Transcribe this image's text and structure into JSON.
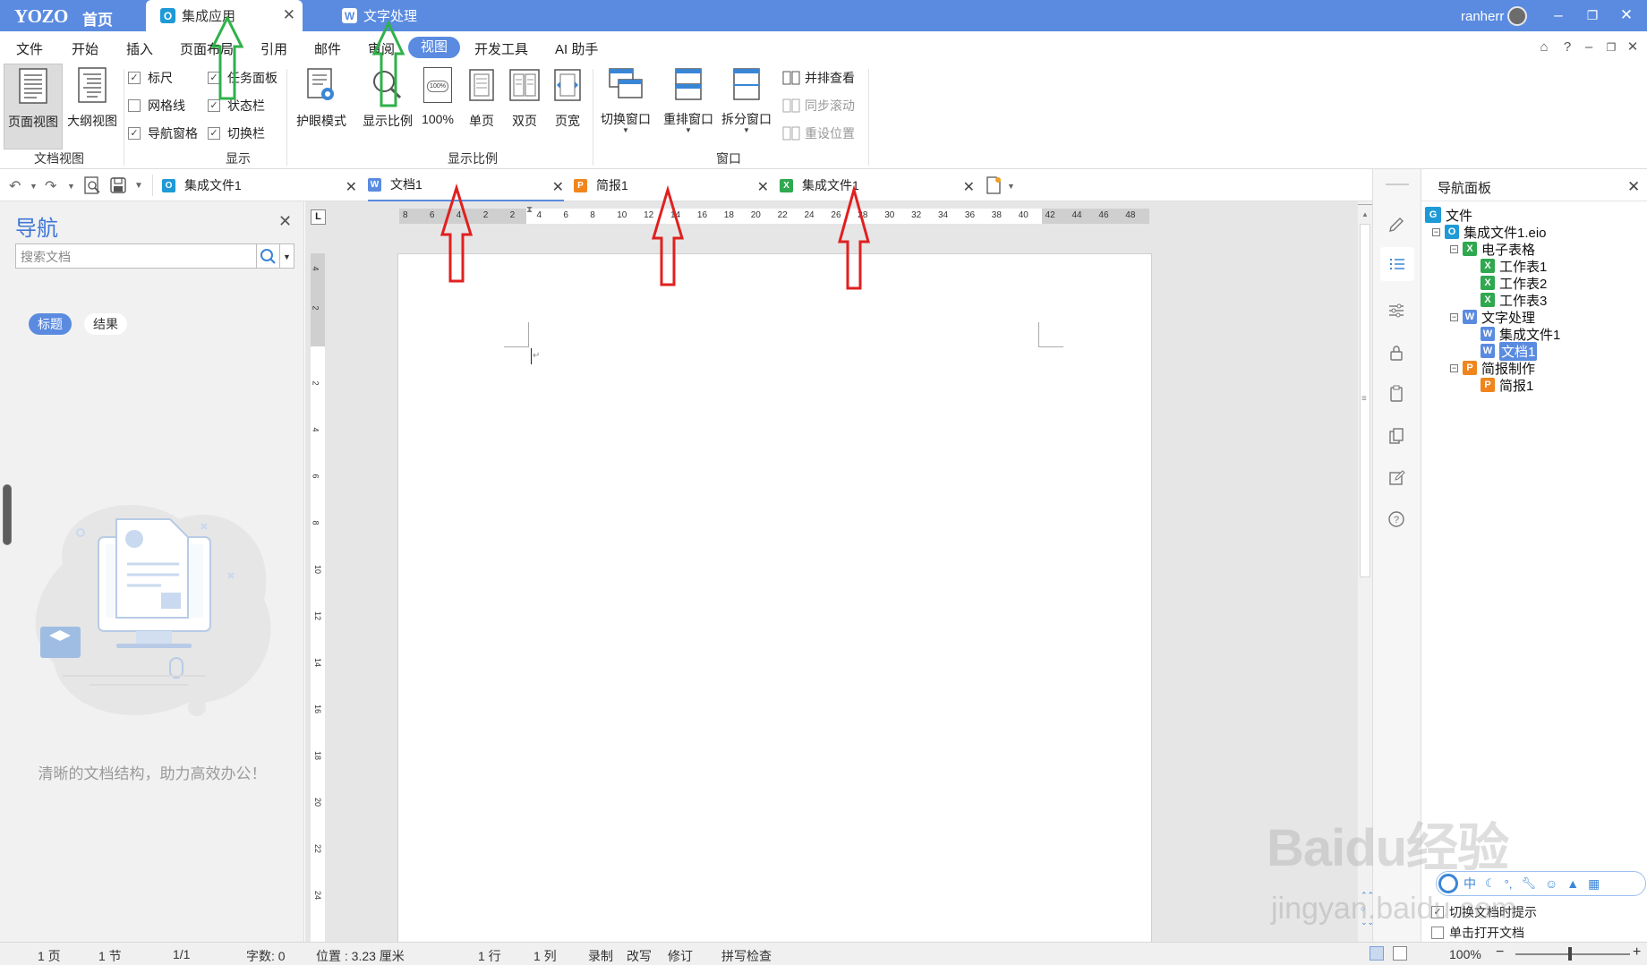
{
  "app": {
    "logo": "YOZO",
    "home_label": "首页",
    "title_tabs": [
      {
        "label": "集成应用",
        "icon": "O",
        "icon_color": "#1e9ad6"
      },
      {
        "label": "文字处理",
        "icon": "W",
        "icon_color": "#5a8be0"
      }
    ],
    "username": "ranherr",
    "accent_color": "#5a8be0"
  },
  "menu": {
    "items": [
      "文件",
      "开始",
      "插入",
      "页面布局",
      "引用",
      "邮件",
      "审阅",
      "视图",
      "开发工具",
      "AI 助手"
    ],
    "active": "视图"
  },
  "ribbon": {
    "doc_view": {
      "page_view": "页面视图",
      "outline_view": "大纲视图",
      "group": "文档视图"
    },
    "show": {
      "ruler": {
        "label": "标尺",
        "checked": true
      },
      "gridlines": {
        "label": "网格线",
        "checked": false
      },
      "nav_pane": {
        "label": "导航窗格",
        "checked": true
      },
      "task_pane": {
        "label": "任务面板",
        "checked": true
      },
      "status_bar": {
        "label": "状态栏",
        "checked": true
      },
      "switch_bar": {
        "label": "切换栏",
        "checked": true
      },
      "group": "显示"
    },
    "zoom": {
      "eye_mode": "护眼模式",
      "zoom_ratio": "显示比例",
      "hundred": "100%",
      "hundred_icon_text": "100%",
      "single": "单页",
      "double": "双页",
      "width": "页宽",
      "group": "显示比例"
    },
    "window": {
      "switch": "切换窗口",
      "rearrange": "重排窗口",
      "split": "拆分窗口",
      "side_by_side": "并排查看",
      "sync_scroll": "同步滚动",
      "reset_pos": "重设位置",
      "group": "窗口"
    }
  },
  "doc_tabs": [
    {
      "label": "集成文件1",
      "icon": "O",
      "color": "#1e9ad6"
    },
    {
      "label": "文档1",
      "icon": "W",
      "color": "#5a8be0"
    },
    {
      "label": "简报1",
      "icon": "P",
      "color": "#f0851d"
    },
    {
      "label": "集成文件1",
      "icon": "X",
      "color": "#2fa84f"
    }
  ],
  "nav": {
    "title": "导航",
    "search_placeholder": "搜索文档",
    "tab_headings": "标题",
    "tab_results": "结果",
    "slogan": "清晰的文档结构，助力高效办公！"
  },
  "ruler": {
    "corner": "L",
    "h_ticks": [
      "8",
      "6",
      "4",
      "2",
      "2",
      "4",
      "6",
      "8",
      "10",
      "12",
      "14",
      "16",
      "18",
      "20",
      "22",
      "24",
      "26",
      "28",
      "30",
      "32",
      "34",
      "36",
      "38",
      "40",
      "42",
      "44",
      "46",
      "48"
    ],
    "v_ticks": [
      "4",
      "2",
      "2",
      "4",
      "6",
      "8",
      "10",
      "12",
      "14",
      "16",
      "18",
      "20",
      "22",
      "24"
    ]
  },
  "nav_panel": {
    "title": "导航面板",
    "tree": {
      "root": "文件",
      "file": "集成文件1.eio",
      "spreadsheet": "电子表格",
      "sheets": [
        "工作表1",
        "工作表2",
        "工作表3"
      ],
      "word": "文字处理",
      "word_items": [
        "集成文件1",
        "文档1"
      ],
      "ppt": "简报制作",
      "ppt_items": [
        "简报1"
      ]
    },
    "switch_label": "切换文档时提示",
    "single_click_label": "单击打开文档",
    "switch_checked": true,
    "single_click_checked": false
  },
  "ime_bar": {
    "mode": "中"
  },
  "status": {
    "page": "1 页",
    "section": "1 节",
    "pages": "1/1",
    "words": "字数: 0",
    "position": "位置 : 3.23 厘米",
    "line": "1 行",
    "col": "1 列",
    "record": "录制",
    "overwrite": "改写",
    "revise": "修订",
    "spell": "拼写检查",
    "zoom": "100%"
  },
  "watermark": {
    "brand": "Baidu经验",
    "site": "jingyan.baidu.com"
  },
  "colors": {
    "green_arrow": "#2fb14a",
    "red_arrow": "#e02020"
  }
}
